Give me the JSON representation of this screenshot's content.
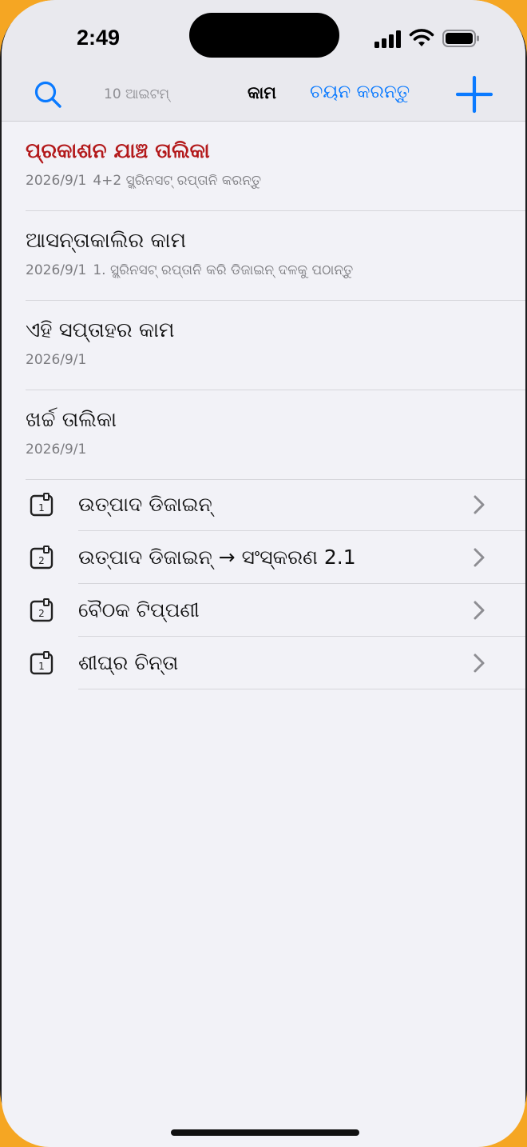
{
  "status": {
    "time": "2:49"
  },
  "toolbar": {
    "count": "10 ଆଇଟମ୍",
    "title": "କାମ",
    "select_label": "ଚୟନ କରନ୍ତୁ"
  },
  "notes": [
    {
      "title": "ପ୍ରକାଶନ ଯାଞ୍ଚ ତାଲିକା",
      "date": "2026/9/1",
      "preview": "4+2 ସ୍କ୍ରିନସଟ୍ ରପ୍ତାନି କରନ୍ତୁ",
      "highlight": true
    },
    {
      "title": "ଆସନ୍ତାକାଲିର କାମ",
      "date": "2026/9/1",
      "preview": "1. ସ୍କ୍ରିନସଟ୍ ରପ୍ତାନି କରି ଡିଜାଇନ୍ ଦଳକୁ ପଠାନ୍ତୁ"
    },
    {
      "title": "ଏହି ସପ୍ତାହର କାମ",
      "date": "2026/9/1",
      "preview": ""
    },
    {
      "title": "ଖର୍ଚ୍ଚ ତାଲିକା",
      "date": "2026/9/1",
      "preview": ""
    }
  ],
  "folders": [
    {
      "count": "1",
      "label": "ଉତ୍ପାଦ ଡିଜାଇନ୍"
    },
    {
      "count": "2",
      "label": "ଉତ୍ପାଦ ଡିଜାଇନ୍ → ସଂସ୍କରଣ 2.1"
    },
    {
      "count": "2",
      "label": "ବୈଠକ ଟିପ୍ପଣୀ"
    },
    {
      "count": "1",
      "label": "ଶୀଘ୍ର ଚିନ୍ତା"
    }
  ],
  "colors": {
    "accent": "#0a7aff",
    "highlight_title": "#b3191b",
    "background": "#f2f2f7",
    "outer": "#f5a623"
  },
  "icons": [
    "search-icon",
    "plus-icon",
    "folder-stack-icon",
    "chevron-right-icon",
    "signal-icon",
    "wifi-icon",
    "battery-icon"
  ]
}
